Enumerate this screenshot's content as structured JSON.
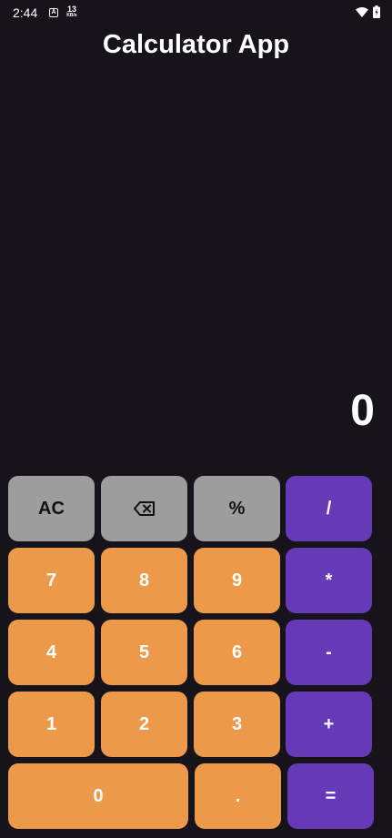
{
  "status_bar": {
    "time": "2:44",
    "a_icon": "A",
    "speed_value": "13",
    "speed_unit": "KB/s"
  },
  "app": {
    "title": "Calculator App"
  },
  "display": {
    "value": "0"
  },
  "keypad": {
    "ac": "AC",
    "backspace_icon": "backspace-icon",
    "percent": "%",
    "divide": "/",
    "seven": "7",
    "eight": "8",
    "nine": "9",
    "multiply": "*",
    "four": "4",
    "five": "5",
    "six": "6",
    "minus": "-",
    "one": "1",
    "two": "2",
    "three": "3",
    "plus": "+",
    "zero": "0",
    "dot": ".",
    "equals": "="
  },
  "colors": {
    "background": "#16141a",
    "function_key": "#9d9d9d",
    "number_key": "#ec9a4a",
    "operator_key": "#6639b7"
  }
}
